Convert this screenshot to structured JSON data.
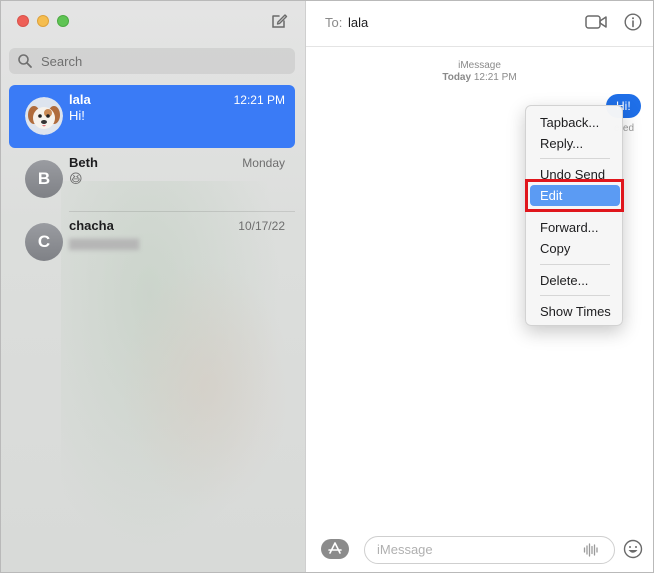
{
  "sidebar": {
    "search_placeholder": "Search",
    "conversations": [
      {
        "name": "lala",
        "time": "12:21 PM",
        "preview": "Hi!",
        "avatar": "dog-memoji"
      },
      {
        "name": "Beth",
        "time": "Monday",
        "preview": "😆",
        "avatar_letter": "B"
      },
      {
        "name": "chacha",
        "time": "10/17/22",
        "preview": "",
        "avatar_letter": "C"
      }
    ]
  },
  "header": {
    "to_label": "To:",
    "recipient": "lala"
  },
  "thread": {
    "service": "iMessage",
    "timestamp_day": "Today",
    "timestamp_time": "12:21 PM",
    "message": "Hi!",
    "status": "ered"
  },
  "context_menu": {
    "items": [
      "Tapback...",
      "Reply...",
      "Undo Send",
      "Edit",
      "Forward...",
      "Copy",
      "Delete...",
      "Show Times"
    ],
    "active": "Edit"
  },
  "composer": {
    "placeholder": "iMessage"
  },
  "colors": {
    "accent": "#3a7bf6",
    "bubble": "#1f6fe8",
    "highlight": "#e0161c"
  }
}
